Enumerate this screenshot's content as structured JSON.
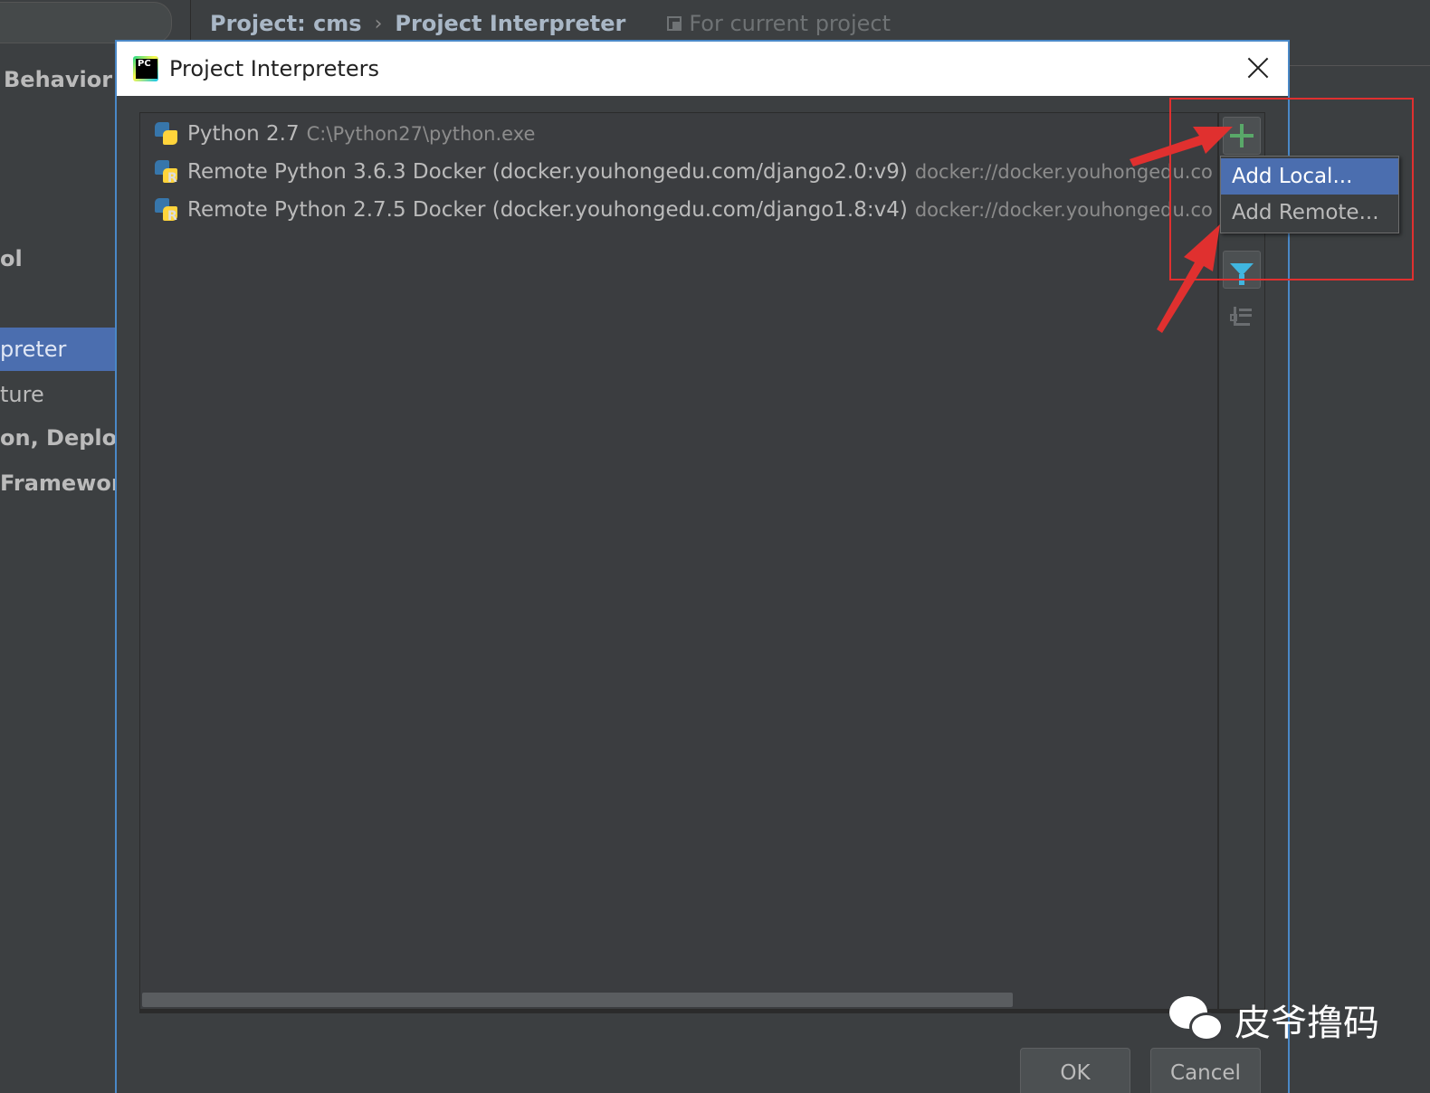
{
  "breadcrumb": {
    "project": "Project: cms",
    "separator": "›",
    "page": "Project Interpreter",
    "scope": "For current project"
  },
  "sidebar": {
    "items": [
      {
        "label": "Behavior",
        "bold": true
      },
      {
        "label": "ol",
        "bold": true
      },
      {
        "label": "preter",
        "selected": true
      },
      {
        "label": "ture"
      },
      {
        "label": "on, Deploym",
        "bold": true
      },
      {
        "label": "Framework",
        "bold": true
      }
    ]
  },
  "dialog": {
    "title": "Project Interpreters",
    "interpreters": [
      {
        "name": "Python 2.7",
        "path": "C:\\Python27\\python.exe",
        "remote": false
      },
      {
        "name": "Remote Python 3.6.3 Docker (docker.youhongedu.com/django2.0:v9)",
        "path": "docker://docker.youhongedu.co",
        "remote": true
      },
      {
        "name": "Remote Python 2.7.5 Docker (docker.youhongedu.com/django1.8:v4)",
        "path": "docker://docker.youhongedu.co",
        "remote": true
      }
    ],
    "toolbar_icons": [
      "plus-icon",
      "filter-icon",
      "tree-icon"
    ],
    "add_menu": {
      "items": [
        "Add Local...",
        "Add Remote..."
      ],
      "selected_index": 0
    },
    "buttons": {
      "ok": "OK",
      "cancel": "Cancel"
    }
  },
  "colors": {
    "background": "#3c3f41",
    "selection": "#4b6eaf",
    "dialog_border": "#4a88c7",
    "annotation": "#e0302f",
    "plus_green": "#59a869",
    "filter_blue": "#40b6e0"
  },
  "watermark": {
    "text": "皮爷撸码",
    "icon": "wechat-icon"
  }
}
